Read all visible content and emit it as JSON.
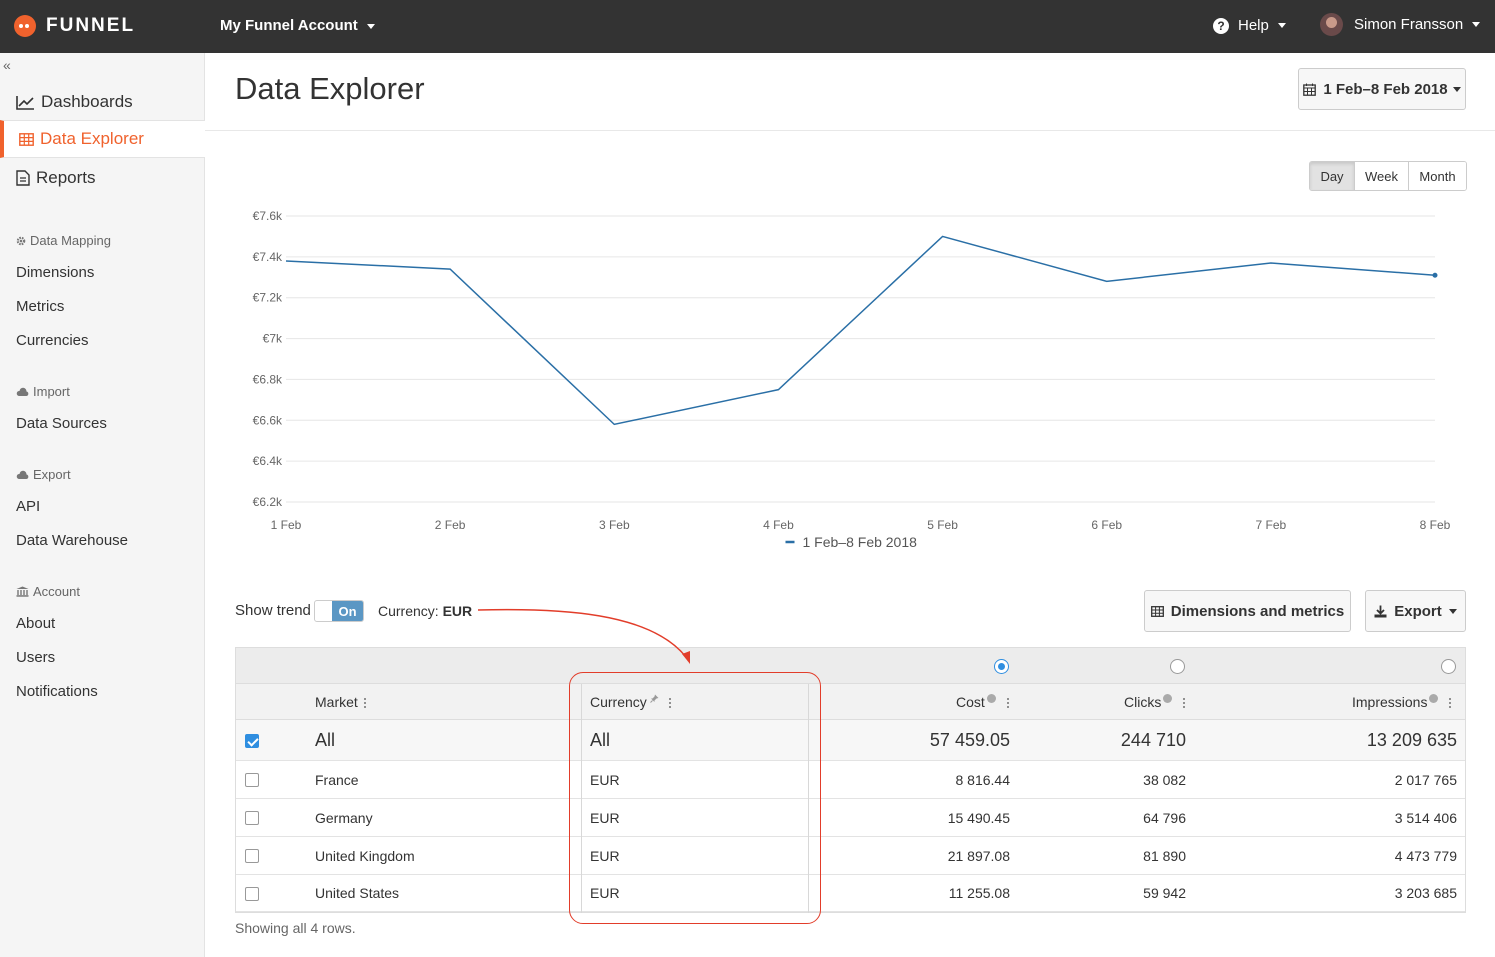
{
  "topbar": {
    "logo_text": "FUNNEL",
    "account": "My Funnel Account",
    "help": "Help",
    "user": "Simon Fransson"
  },
  "sidebar": {
    "main": [
      {
        "label": "Dashboards",
        "icon": "line-chart-icon"
      },
      {
        "label": "Data Explorer",
        "icon": "table-icon",
        "active": true
      },
      {
        "label": "Reports",
        "icon": "document-icon"
      }
    ],
    "sections": [
      {
        "title": "Data Mapping",
        "icon": "gear-icon",
        "items": [
          "Dimensions",
          "Metrics",
          "Currencies"
        ]
      },
      {
        "title": "Import",
        "icon": "cloud-icon",
        "items": [
          "Data Sources"
        ]
      },
      {
        "title": "Export",
        "icon": "cloud-icon",
        "items": [
          "API",
          "Data Warehouse"
        ]
      },
      {
        "title": "Account",
        "icon": "bank-icon",
        "items": [
          "About",
          "Users",
          "Notifications"
        ]
      }
    ]
  },
  "page": {
    "title": "Data Explorer",
    "date_range": "1 Feb–8 Feb 2018",
    "periods": [
      "Day",
      "Week",
      "Month"
    ],
    "selected_period": "Day"
  },
  "chart_data": {
    "type": "line",
    "categories": [
      "1 Feb",
      "2 Feb",
      "3 Feb",
      "4 Feb",
      "5 Feb",
      "6 Feb",
      "7 Feb",
      "8 Feb"
    ],
    "series": [
      {
        "name": "1 Feb–8 Feb 2018",
        "values": [
          7380,
          7340,
          6580,
          6750,
          7500,
          7280,
          7370,
          7310
        ],
        "color": "#2a6fa6"
      }
    ],
    "y_ticks": [
      "€7.6k",
      "€7.4k",
      "€7.2k",
      "€7k",
      "€6.8k",
      "€6.6k",
      "€6.4k",
      "€6.2k"
    ],
    "ylim": [
      6200,
      7600
    ],
    "grid": true,
    "legend_position": "bottom"
  },
  "controls": {
    "show_trend": "Show trend",
    "toggle": "On",
    "currency_label": "Currency:",
    "currency_value": "EUR",
    "dimensions_button": "Dimensions and metrics",
    "export_button": "Export"
  },
  "table": {
    "headers": {
      "market": "Market",
      "currency": "Currency",
      "cost": "Cost",
      "clicks": "Clicks",
      "impressions": "Impressions"
    },
    "metric_selected": "Cost",
    "rows": [
      {
        "market": "All",
        "currency": "All",
        "cost": "57 459.05",
        "clicks": "244 710",
        "impressions": "13 209 635",
        "checked": true
      },
      {
        "market": "France",
        "currency": "EUR",
        "cost": "8 816.44",
        "clicks": "38 082",
        "impressions": "2 017 765",
        "checked": false
      },
      {
        "market": "Germany",
        "currency": "EUR",
        "cost": "15 490.45",
        "clicks": "64 796",
        "impressions": "3 514 406",
        "checked": false
      },
      {
        "market": "United Kingdom",
        "currency": "EUR",
        "cost": "21 897.08",
        "clicks": "81 890",
        "impressions": "4 473 779",
        "checked": false
      },
      {
        "market": "United States",
        "currency": "EUR",
        "cost": "11 255.08",
        "clicks": "59 942",
        "impressions": "3 203 685",
        "checked": false
      }
    ],
    "footer": "Showing all 4 rows."
  },
  "colors": {
    "accent": "#f0622d",
    "topbar": "#333333",
    "line": "#2a6fa6",
    "annotation": "#e23d2a",
    "toggle": "#5b97c4"
  }
}
